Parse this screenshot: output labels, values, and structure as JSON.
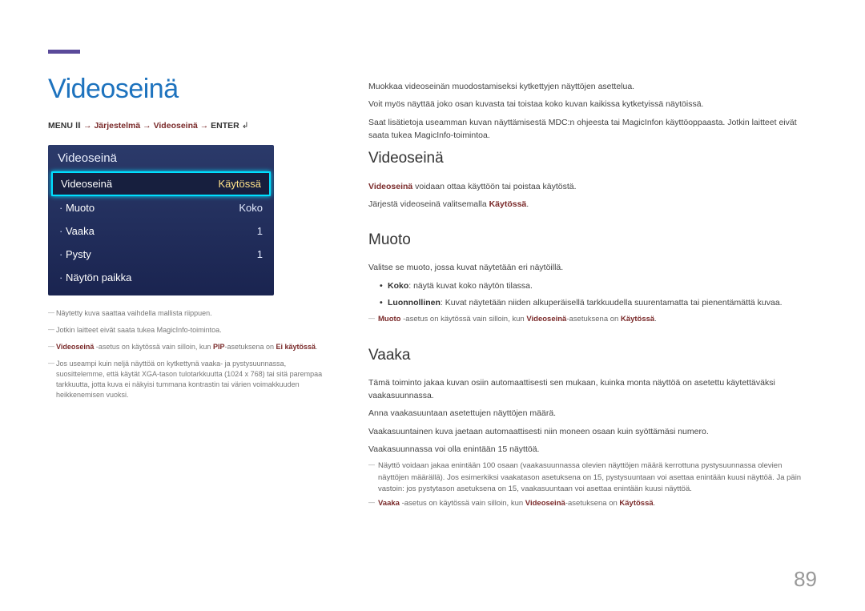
{
  "page_number": "89",
  "heading": "Videoseinä",
  "menu_path": {
    "prefix": "MENU",
    "icon1": "Ⅲ",
    "arrow": " → ",
    "p1": "Järjestelmä",
    "p2": "Videoseinä",
    "p3": "ENTER",
    "icon2": "↲"
  },
  "osd": {
    "title": "Videoseinä",
    "selected": {
      "label": "Videoseinä",
      "value": "Käytössä"
    },
    "rows": [
      {
        "label": "Muoto",
        "value": "Koko"
      },
      {
        "label": "Vaaka",
        "value": "1"
      },
      {
        "label": "Pysty",
        "value": "1"
      },
      {
        "label": "Näytön paikka",
        "value": ""
      }
    ]
  },
  "left_footnotes": {
    "fn1": "Näytetty kuva saattaa vaihdella mallista riippuen.",
    "fn2": "Jotkin laitteet eivät saata tukea MagicInfo-toimintoa.",
    "fn3_pre": "",
    "fn3_kw1": "Videoseinä",
    "fn3_mid": " -asetus on käytössä vain silloin, kun ",
    "fn3_kw2": "PIP",
    "fn3_mid2": "-asetuksena on ",
    "fn3_kw3": "Ei käytössä",
    "fn3_end": ".",
    "fn4": "Jos useampi kuin neljä näyttöä on kytkettynä vaaka- ja pystysuunnassa, suosittelemme, että käytät XGA-tason tulotarkkuutta (1024 x 768) tai sitä parempaa tarkkuutta, jotta kuva ei näkyisi tummana kontrastin tai värien voimakkuuden heikkenemisen vuoksi."
  },
  "right": {
    "intro1": "Muokkaa videoseinän muodostamiseksi kytkettyjen näyttöjen asettelua.",
    "intro2": "Voit myös näyttää joko osan kuvasta tai toistaa koko kuvan kaikissa kytketyissä näytöissä.",
    "intro3": "Saat lisätietoja useamman kuvan näyttämisestä MDC:n ohjeesta tai MagicInfon käyttöoppaasta. Jotkin laitteet eivät saata tukea MagicInfo-toimintoa.",
    "sec1_h": "Videoseinä",
    "sec1_p1_kw": "Videoseinä",
    "sec1_p1_rest": " voidaan ottaa käyttöön tai poistaa käytöstä.",
    "sec1_p2_pre": "Järjestä videoseinä valitsemalla ",
    "sec1_p2_kw": "Käytössä",
    "sec1_p2_end": ".",
    "sec2_h": "Muoto",
    "sec2_p1": "Valitse se muoto, jossa kuvat näytetään eri näytöillä.",
    "sec2_li1_kw": "Koko",
    "sec2_li1_rest": ": näytä kuvat koko näytön tilassa.",
    "sec2_li2_kw": "Luonnollinen",
    "sec2_li2_rest": ": Kuvat näytetään niiden alkuperäisellä tarkkuudella suurentamatta tai pienentämättä kuvaa.",
    "sec2_fn_kw1": "Muoto",
    "sec2_fn_mid": " -asetus on käytössä vain silloin, kun ",
    "sec2_fn_kw2": "Videoseinä",
    "sec2_fn_mid2": "-asetuksena on ",
    "sec2_fn_kw3": "Käytössä",
    "sec2_fn_end": ".",
    "sec3_h": "Vaaka",
    "sec3_p1": "Tämä toiminto jakaa kuvan osiin automaattisesti sen mukaan, kuinka monta näyttöä on asetettu käytettäväksi vaakasuunnassa.",
    "sec3_p2": "Anna vaakasuuntaan asetettujen näyttöjen määrä.",
    "sec3_p3": "Vaakasuuntainen kuva jaetaan automaattisesti niin moneen osaan kuin syöttämäsi numero.",
    "sec3_p4": "Vaakasuunnassa voi olla enintään 15 näyttöä.",
    "sec3_fn1": "Näyttö voidaan jakaa enintään 100 osaan (vaakasuunnassa olevien näyttöjen määrä kerrottuna pystysuunnassa olevien näyttöjen määrällä). Jos esimerkiksi vaakatason asetuksena on 15, pystysuuntaan voi asettaa enintään kuusi näyttöä. Ja päin vastoin: jos pystytason asetuksena on 15, vaakasuuntaan voi asettaa enintään kuusi näyttöä.",
    "sec3_fn2_kw1": "Vaaka",
    "sec3_fn2_mid": " -asetus on käytössä vain silloin, kun ",
    "sec3_fn2_kw2": "Videoseinä",
    "sec3_fn2_mid2": "-asetuksena on ",
    "sec3_fn2_kw3": "Käytössä",
    "sec3_fn2_end": "."
  }
}
